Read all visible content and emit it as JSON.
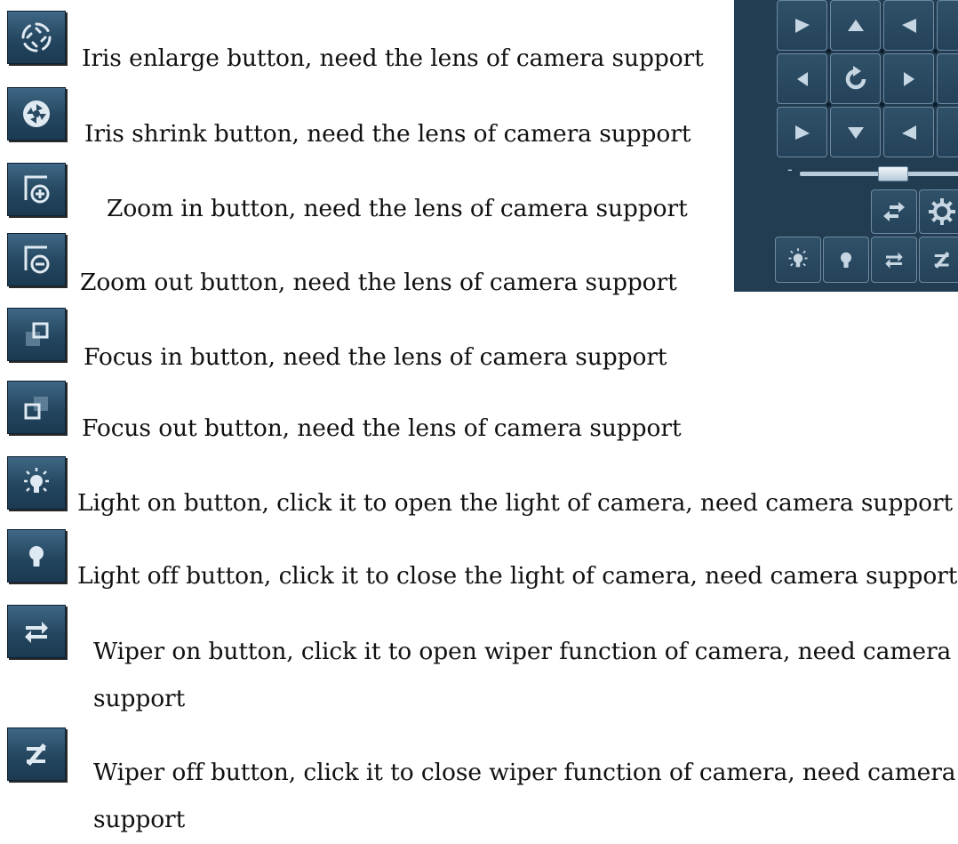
{
  "items": [
    {
      "icon": "iris-enlarge-icon",
      "text": "Iris enlarge button, need the lens of camera support"
    },
    {
      "icon": "iris-shrink-icon",
      "text": "Iris shrink button, need the lens of camera support"
    },
    {
      "icon": "zoom-in-icon",
      "text": "Zoom in button, need the lens of camera support"
    },
    {
      "icon": "zoom-out-icon",
      "text": "Zoom out button, need the lens of camera support"
    },
    {
      "icon": "focus-in-icon",
      "text": "Focus in button, need the lens of camera support"
    },
    {
      "icon": "focus-out-icon",
      "text": "Focus out button, need the lens of camera support"
    },
    {
      "icon": "light-on-icon",
      "text": "Light on button, click it to open the light of camera, need camera support"
    },
    {
      "icon": "light-off-icon",
      "text": "Light off button, click it to close the light of camera, need camera support"
    },
    {
      "icon": "wiper-on-icon",
      "text": "Wiper on button, click it to open wiper function of camera, need camera",
      "text_cont": "support"
    },
    {
      "icon": "wiper-off-icon",
      "text": "Wiper off button, click it to close wiper function of camera, need camera",
      "text_cont": "support"
    }
  ],
  "ptz_panel": {
    "zoom_label": "-",
    "zoom_level": 0.55,
    "colors": {
      "panel": "#223c51",
      "button": "#2a4a62",
      "glyph": "#c6d6e2"
    }
  }
}
